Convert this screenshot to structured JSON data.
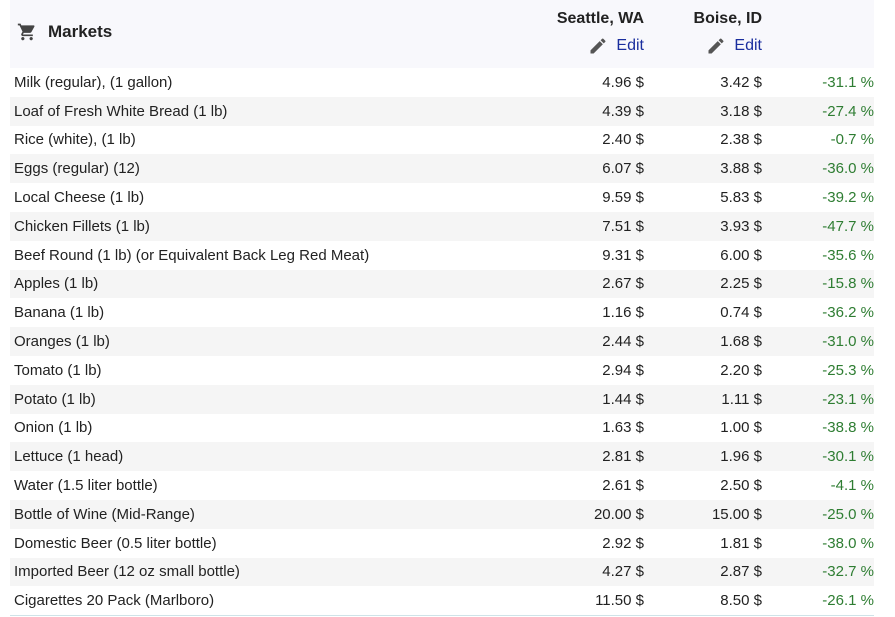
{
  "header": {
    "title": "Markets",
    "cities": [
      "Seattle, WA",
      "Boise, ID"
    ],
    "edit_label": "Edit"
  },
  "colors": {
    "negative_diff": "#2e7d32",
    "link": "#1a2e9e",
    "header_bg": "#f8f8fc"
  },
  "rows": [
    {
      "item": "Milk (regular), (1 gallon)",
      "seattle": "4.96 $",
      "boise": "3.42 $",
      "diff": "-31.1 %"
    },
    {
      "item": "Loaf of Fresh White Bread (1 lb)",
      "seattle": "4.39 $",
      "boise": "3.18 $",
      "diff": "-27.4 %"
    },
    {
      "item": "Rice (white), (1 lb)",
      "seattle": "2.40 $",
      "boise": "2.38 $",
      "diff": "-0.7 %"
    },
    {
      "item": "Eggs (regular) (12)",
      "seattle": "6.07 $",
      "boise": "3.88 $",
      "diff": "-36.0 %"
    },
    {
      "item": "Local Cheese (1 lb)",
      "seattle": "9.59 $",
      "boise": "5.83 $",
      "diff": "-39.2 %"
    },
    {
      "item": "Chicken Fillets (1 lb)",
      "seattle": "7.51 $",
      "boise": "3.93 $",
      "diff": "-47.7 %"
    },
    {
      "item": "Beef Round (1 lb) (or Equivalent Back Leg Red Meat)",
      "seattle": "9.31 $",
      "boise": "6.00 $",
      "diff": "-35.6 %"
    },
    {
      "item": "Apples (1 lb)",
      "seattle": "2.67 $",
      "boise": "2.25 $",
      "diff": "-15.8 %"
    },
    {
      "item": "Banana (1 lb)",
      "seattle": "1.16 $",
      "boise": "0.74 $",
      "diff": "-36.2 %"
    },
    {
      "item": "Oranges (1 lb)",
      "seattle": "2.44 $",
      "boise": "1.68 $",
      "diff": "-31.0 %"
    },
    {
      "item": "Tomato (1 lb)",
      "seattle": "2.94 $",
      "boise": "2.20 $",
      "diff": "-25.3 %"
    },
    {
      "item": "Potato (1 lb)",
      "seattle": "1.44 $",
      "boise": "1.11 $",
      "diff": "-23.1 %"
    },
    {
      "item": "Onion (1 lb)",
      "seattle": "1.63 $",
      "boise": "1.00 $",
      "diff": "-38.8 %"
    },
    {
      "item": "Lettuce (1 head)",
      "seattle": "2.81 $",
      "boise": "1.96 $",
      "diff": "-30.1 %"
    },
    {
      "item": "Water (1.5 liter bottle)",
      "seattle": "2.61 $",
      "boise": "2.50 $",
      "diff": "-4.1 %"
    },
    {
      "item": "Bottle of Wine (Mid-Range)",
      "seattle": "20.00 $",
      "boise": "15.00 $",
      "diff": "-25.0 %"
    },
    {
      "item": "Domestic Beer (0.5 liter bottle)",
      "seattle": "2.92 $",
      "boise": "1.81 $",
      "diff": "-38.0 %"
    },
    {
      "item": "Imported Beer (12 oz small bottle)",
      "seattle": "4.27 $",
      "boise": "2.87 $",
      "diff": "-32.7 %"
    },
    {
      "item": "Cigarettes 20 Pack (Marlboro)",
      "seattle": "11.50 $",
      "boise": "8.50 $",
      "diff": "-26.1 %"
    }
  ]
}
